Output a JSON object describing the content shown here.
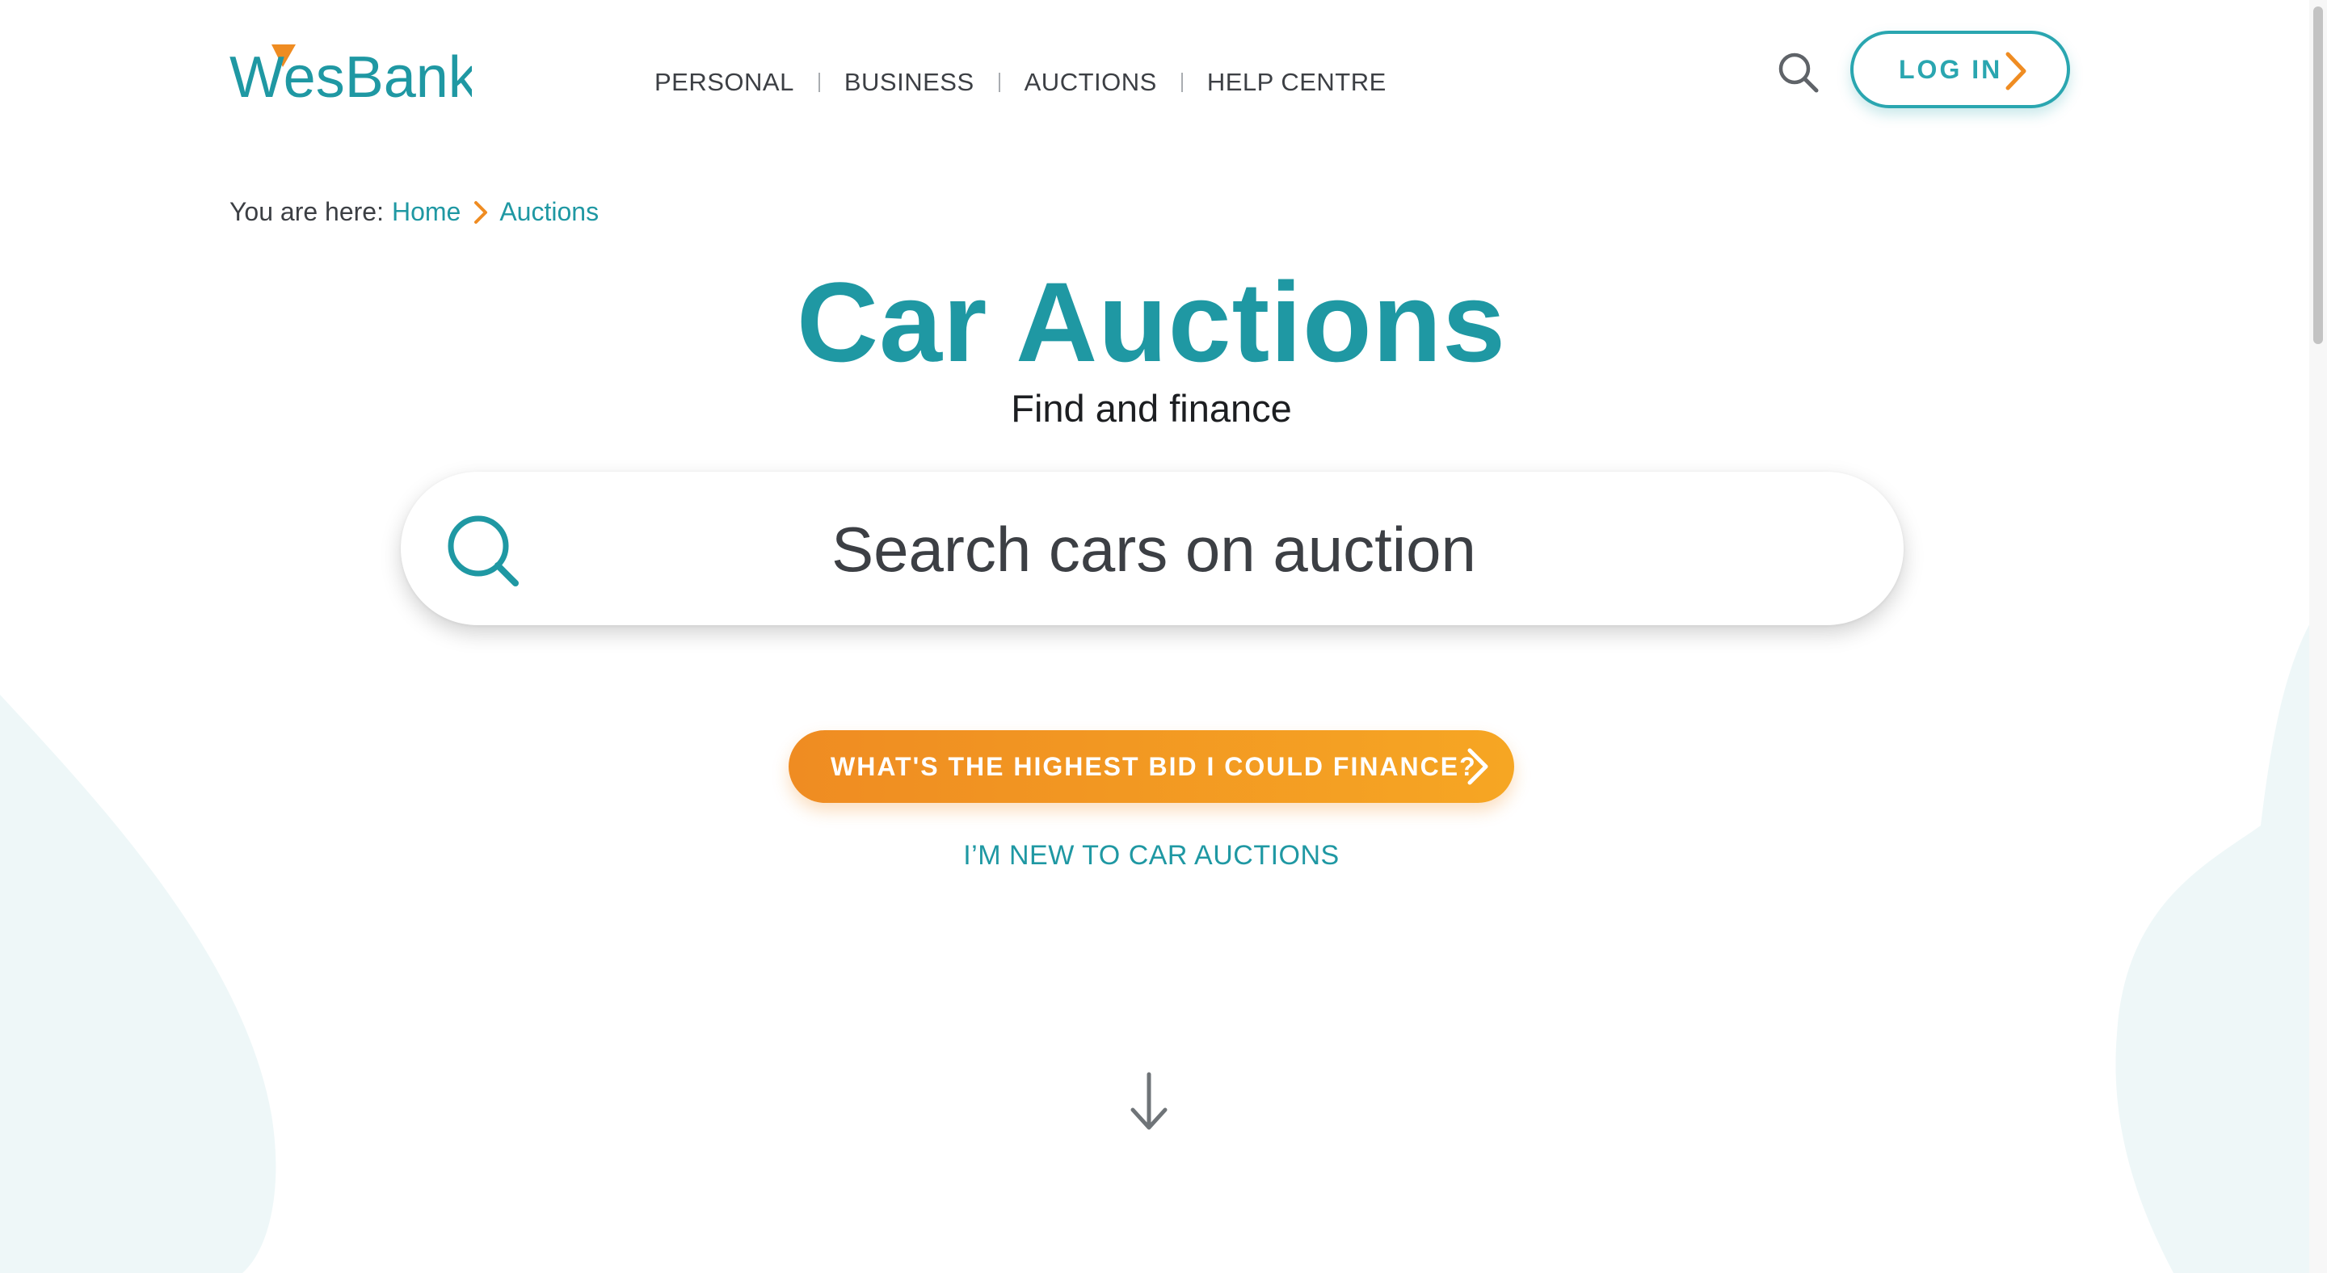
{
  "brand": {
    "logo_text": "WesBank",
    "primary_color": "#1f98a3",
    "accent_color": "#ef8c22"
  },
  "nav": {
    "items": [
      "PERSONAL",
      "BUSINESS",
      "AUCTIONS",
      "HELP CENTRE"
    ]
  },
  "header": {
    "search_icon": "search-icon",
    "login_label": "LOG IN"
  },
  "breadcrumb": {
    "prefix": "You are here:",
    "items": [
      "Home",
      "Auctions"
    ]
  },
  "hero": {
    "title": "Car Auctions",
    "subtitle": "Find and finance"
  },
  "search": {
    "placeholder": "Search cars on auction",
    "icon": "search-icon"
  },
  "cta": {
    "label": "WHAT'S THE HIGHEST BID I COULD FINANCE?",
    "icon": "chevron-right-icon"
  },
  "secondary_link": {
    "label": "I’M NEW TO CAR AUCTIONS"
  },
  "scroll_indicator": {
    "icon": "arrow-down-icon"
  }
}
